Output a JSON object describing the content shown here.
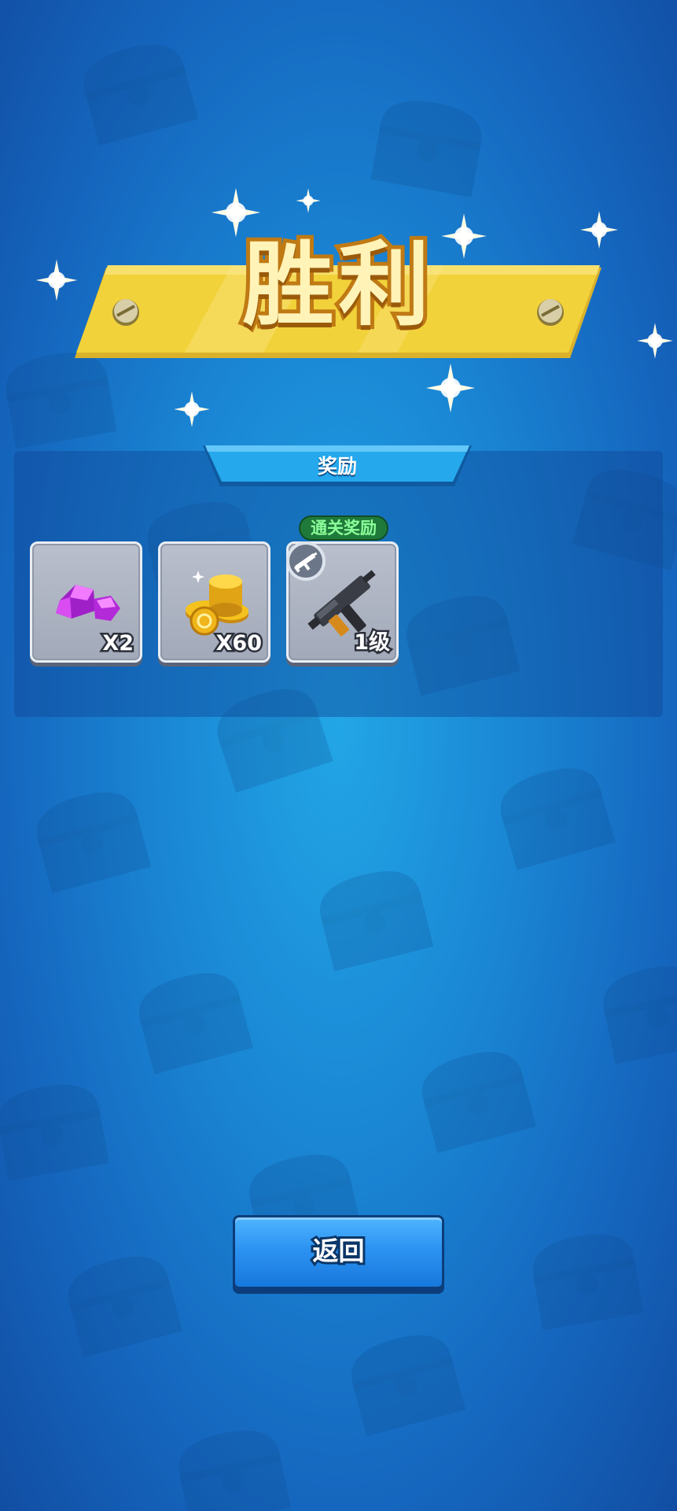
{
  "screen": {
    "title": "胜利",
    "reward_header": "奖励",
    "clear_reward_badge": "通关奖励",
    "return_label": "返回"
  },
  "rewards": [
    {
      "icon": "gem-icon",
      "quantity": "X2"
    },
    {
      "icon": "gold-coins-icon",
      "quantity": "X60"
    },
    {
      "icon": "smg-weapon-icon",
      "quantity": "1级"
    }
  ],
  "colors": {
    "background": "#1a86d4",
    "banner": "#f2d23a",
    "title_outline": "#c07a14",
    "button": "#2d93f2",
    "badge": "#1f7a3a"
  }
}
